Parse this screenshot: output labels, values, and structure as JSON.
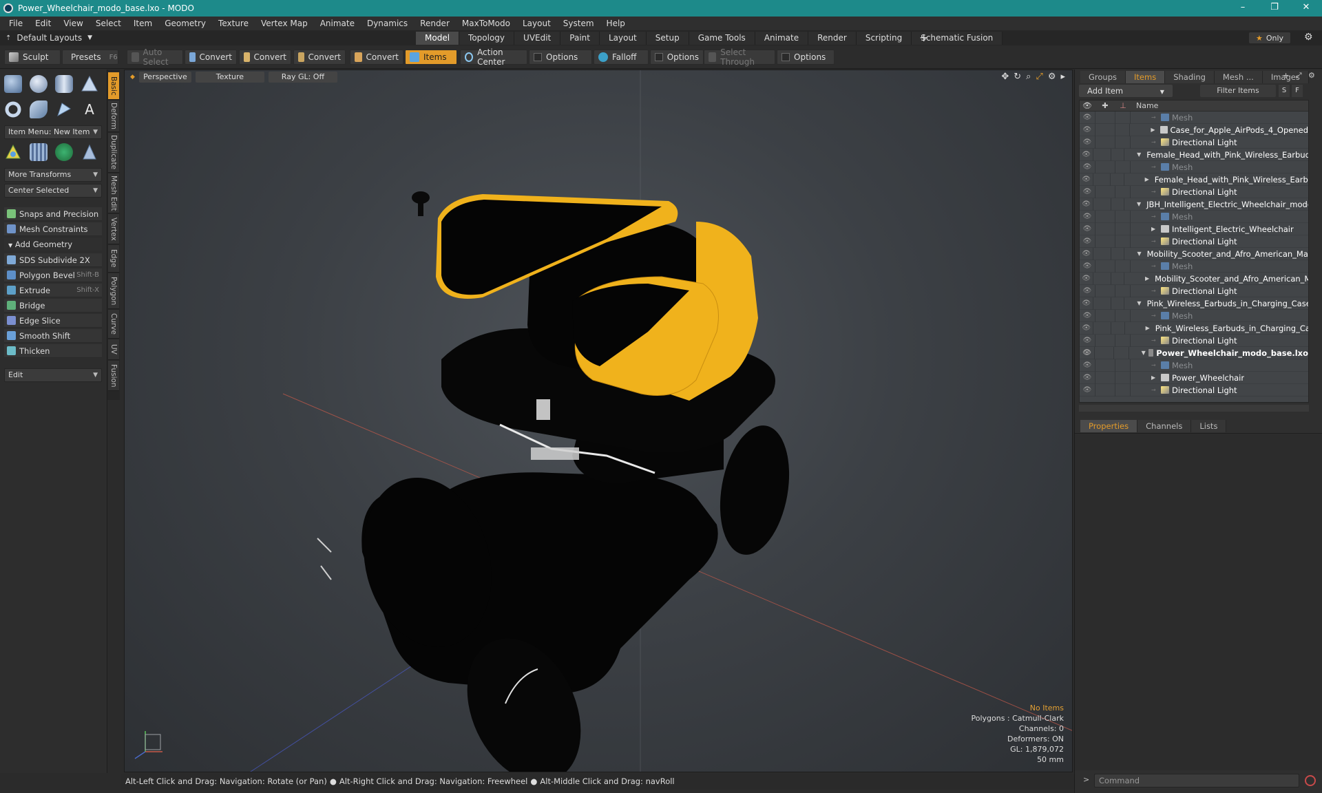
{
  "window": {
    "title": "Power_Wheelchair_modo_base.lxo - MODO",
    "controls": [
      "–",
      "❐",
      "✕"
    ]
  },
  "menu": [
    "File",
    "Edit",
    "View",
    "Select",
    "Item",
    "Geometry",
    "Texture",
    "Vertex Map",
    "Animate",
    "Dynamics",
    "Render",
    "MaxToModo",
    "Layout",
    "System",
    "Help"
  ],
  "layoutbar": {
    "layout_label": "Default Layouts",
    "tabs": [
      "Model",
      "Topology",
      "UVEdit",
      "Paint",
      "Layout",
      "Setup",
      "Game Tools",
      "Animate",
      "Render",
      "Scripting",
      "Schematic Fusion"
    ],
    "active_tab": "Model",
    "only_label": "Only"
  },
  "toolbar": {
    "sculpt": "Sculpt",
    "presets": "Presets",
    "presets_key": "F6",
    "auto_select": "Auto Select",
    "convert": "Convert",
    "items": "Items",
    "action_center": "Action Center",
    "options": "Options",
    "falloff": "Falloff",
    "select_through": "Select Through"
  },
  "leftpanel": {
    "item_menu": "Item Menu: New Item",
    "more_transforms": "More Transforms",
    "center_selected": "Center Selected",
    "snaps": "Snaps and Precision",
    "mesh_constraints": "Mesh Constraints",
    "add_geometry": "Add Geometry",
    "tools": [
      {
        "label": "SDS Subdivide 2X",
        "key": ""
      },
      {
        "label": "Polygon Bevel",
        "key": "Shift-B"
      },
      {
        "label": "Extrude",
        "key": "Shift-X"
      },
      {
        "label": "Bridge",
        "key": ""
      },
      {
        "label": "Edge Slice",
        "key": ""
      },
      {
        "label": "Smooth Shift",
        "key": ""
      },
      {
        "label": "Thicken",
        "key": ""
      }
    ],
    "edit": "Edit"
  },
  "sidetabs": [
    "Basic",
    "Deform",
    "Duplicate",
    "Mesh Edit",
    "Vertex",
    "Edge",
    "Polygon",
    "Curve",
    "UV",
    "Fusion"
  ],
  "viewport": {
    "view": "Perspective",
    "shading": "Texture",
    "raygl": "Ray GL: Off",
    "info": {
      "selection": "No Items",
      "polygons": "Polygons : Catmull-Clark",
      "channels": "Channels: 0",
      "deformers": "Deformers: ON",
      "gl": "GL: 1,879,072",
      "focal": "50 mm"
    }
  },
  "statusbar": [
    "Alt-Left Click and Drag: Navigation: Rotate (or Pan)",
    "Alt-Right Click and Drag: Navigation: Freewheel",
    "Alt-Middle Click and Drag: navRoll"
  ],
  "rightpanel": {
    "top_tabs": [
      "Groups",
      "Items",
      "Shading",
      "Mesh ...",
      "Images"
    ],
    "active_top_tab": "Items",
    "add_item": "Add Item",
    "filter": "Filter Items",
    "filter_btn_s": "S",
    "filter_btn_f": "F",
    "column_name": "Name",
    "items": [
      {
        "label": "Mesh",
        "type": "mesh",
        "indent": 2
      },
      {
        "label": "Case_for_Apple_AirPods_4_Opened",
        "type": "mesh-item",
        "indent": 2
      },
      {
        "label": "Directional Light",
        "type": "light",
        "indent": 2
      },
      {
        "label": "Female_Head_with_Pink_Wireless_Earbuds...",
        "type": "scene",
        "indent": 1
      },
      {
        "label": "Mesh",
        "type": "mesh",
        "indent": 2
      },
      {
        "label": "Female_Head_with_Pink_Wireless_Earbuds",
        "type": "mesh-item",
        "indent": 2
      },
      {
        "label": "Directional Light",
        "type": "light",
        "indent": 2
      },
      {
        "label": "JBH_Intelligent_Electric_Wheelchair_modo ...",
        "type": "scene",
        "indent": 1
      },
      {
        "label": "Mesh",
        "type": "mesh",
        "indent": 2
      },
      {
        "label": "Intelligent_Electric_Wheelchair",
        "type": "mesh-item",
        "indent": 2
      },
      {
        "label": "Directional Light",
        "type": "light",
        "indent": 2
      },
      {
        "label": "Mobility_Scooter_and_Afro_American_Man...",
        "type": "scene",
        "indent": 1
      },
      {
        "label": "Mesh",
        "type": "mesh",
        "indent": 2
      },
      {
        "label": "Mobility_Scooter_and_Afro_American_Man",
        "type": "mesh-item",
        "indent": 2
      },
      {
        "label": "Directional Light",
        "type": "light",
        "indent": 2
      },
      {
        "label": "Pink_Wireless_Earbuds_in_Charging_Case ...",
        "type": "scene",
        "indent": 1
      },
      {
        "label": "Mesh",
        "type": "mesh",
        "indent": 2
      },
      {
        "label": "Pink_Wireless_Earbuds_in_Charging_Case",
        "type": "mesh-item",
        "indent": 2
      },
      {
        "label": "Directional Light",
        "type": "light",
        "indent": 2
      },
      {
        "label": "Power_Wheelchair_modo_base.lxo",
        "type": "scene",
        "indent": 1,
        "bold": true
      },
      {
        "label": "Mesh",
        "type": "mesh",
        "indent": 2
      },
      {
        "label": "Power_Wheelchair",
        "type": "mesh-item",
        "indent": 2
      },
      {
        "label": "Directional Light",
        "type": "light",
        "indent": 2
      }
    ],
    "bottom_tabs": [
      "Properties",
      "Channels",
      "Lists"
    ],
    "active_bottom_tab": "Properties",
    "command_placeholder": "Command"
  },
  "colors": {
    "accent": "#e39b2a",
    "titlebar": "#1d8a8a",
    "mesh_yellow": "#f0b21c"
  }
}
